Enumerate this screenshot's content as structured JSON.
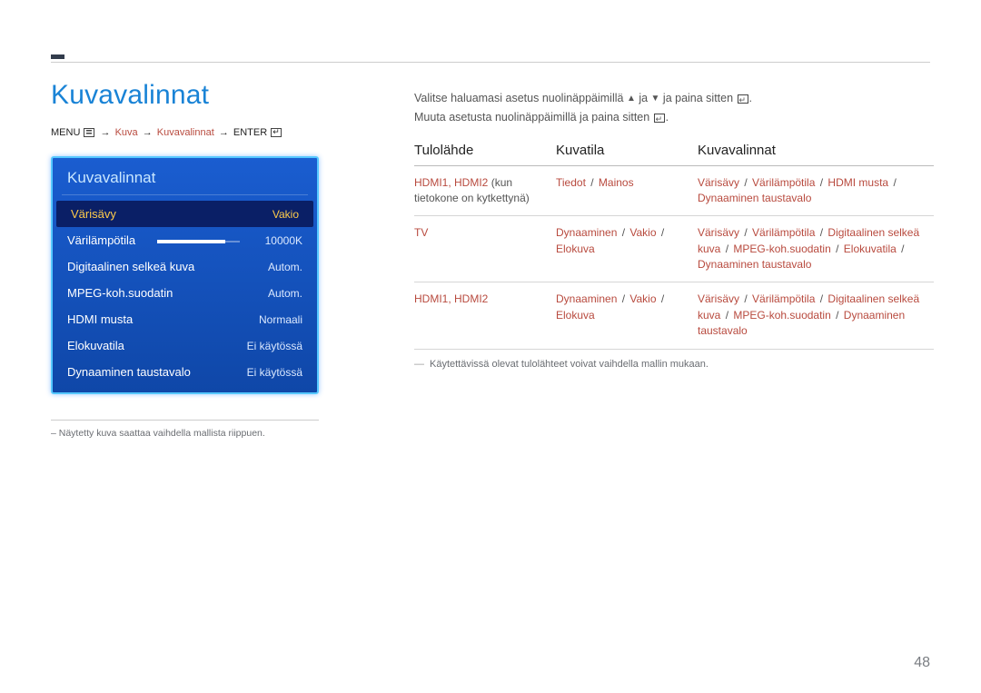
{
  "title": "Kuvavalinnat",
  "breadcrumb": {
    "pre": "MENU",
    "parts": [
      "Kuva",
      "Kuvavalinnat"
    ],
    "post": "ENTER"
  },
  "panel": {
    "title": "Kuvavalinnat",
    "rows": [
      {
        "label": "Värisävy",
        "value": "Vakio",
        "selected": true
      },
      {
        "label": "Värilämpötila",
        "value": "10000K",
        "slider": true
      },
      {
        "label": "Digitaalinen selkeä kuva",
        "value": "Autom."
      },
      {
        "label": "MPEG-koh.suodatin",
        "value": "Autom."
      },
      {
        "label": "HDMI musta",
        "value": "Normaali"
      },
      {
        "label": "Elokuvatila",
        "value": "Ei käytössä"
      },
      {
        "label": "Dynaaminen taustavalo",
        "value": "Ei käytössä"
      }
    ]
  },
  "left_note": "–  Näytetty kuva saattaa vaihdella mallista riippuen.",
  "instr": {
    "l1a": "Valitse haluamasi asetus nuolinäppäimillä ",
    "l1b": " ja ",
    "l1c": " ja paina sitten ",
    "l2a": "Muuta asetusta nuolinäppäimillä ja paina sitten "
  },
  "table": {
    "headers": [
      "Tulolähde",
      "Kuvatila",
      "Kuvavalinnat"
    ],
    "rows": [
      {
        "c1": {
          "parts": [
            [
              "HDMI1",
              "r"
            ],
            [
              ", ",
              "r"
            ],
            [
              "HDMI2",
              "r"
            ],
            [
              " (kun tietokone on kytkettynä)",
              "p"
            ]
          ]
        },
        "c2": {
          "parts": [
            [
              "Tiedot",
              "r"
            ],
            [
              " / ",
              "s"
            ],
            [
              "Mainos",
              "r"
            ]
          ]
        },
        "c3": {
          "parts": [
            [
              "Värisävy",
              "r"
            ],
            [
              " / ",
              "s"
            ],
            [
              "Värilämpötila",
              "r"
            ],
            [
              " / ",
              "s"
            ],
            [
              "HDMI musta",
              "r"
            ],
            [
              " / ",
              "s"
            ],
            [
              "Dynaaminen taustavalo",
              "r"
            ]
          ]
        }
      },
      {
        "c1": {
          "parts": [
            [
              "TV",
              "r"
            ]
          ]
        },
        "c2": {
          "parts": [
            [
              "Dynaaminen",
              "r"
            ],
            [
              " / ",
              "s"
            ],
            [
              "Vakio",
              "r"
            ],
            [
              " / ",
              "s"
            ],
            [
              "Elokuva",
              "r"
            ]
          ]
        },
        "c3": {
          "parts": [
            [
              "Värisävy",
              "r"
            ],
            [
              " / ",
              "s"
            ],
            [
              "Värilämpötila",
              "r"
            ],
            [
              " / ",
              "s"
            ],
            [
              "Digitaalinen selkeä kuva",
              "r"
            ],
            [
              " / ",
              "s"
            ],
            [
              "MPEG-koh.suodatin",
              "r"
            ],
            [
              " / ",
              "s"
            ],
            [
              "Elokuvatila",
              "r"
            ],
            [
              " / ",
              "s"
            ],
            [
              "Dynaaminen taustavalo",
              "r"
            ]
          ]
        }
      },
      {
        "c1": {
          "parts": [
            [
              "HDMI1",
              "r"
            ],
            [
              ", ",
              "r"
            ],
            [
              "HDMI2",
              "r"
            ]
          ]
        },
        "c2": {
          "parts": [
            [
              "Dynaaminen",
              "r"
            ],
            [
              " / ",
              "s"
            ],
            [
              "Vakio",
              "r"
            ],
            [
              " / ",
              "s"
            ],
            [
              "Elokuva",
              "r"
            ]
          ]
        },
        "c3": {
          "parts": [
            [
              "Värisävy",
              "r"
            ],
            [
              " / ",
              "s"
            ],
            [
              "Värilämpötila",
              "r"
            ],
            [
              " / ",
              "s"
            ],
            [
              "Digitaalinen selkeä kuva",
              "r"
            ],
            [
              " / ",
              "s"
            ],
            [
              "MPEG-koh.suodatin",
              "r"
            ],
            [
              " / ",
              "s"
            ],
            [
              "Dynaaminen taustavalo",
              "r"
            ]
          ]
        }
      }
    ]
  },
  "foot_note": "Käytettävissä olevat tulolähteet voivat vaihdella mallin mukaan.",
  "page": "48"
}
